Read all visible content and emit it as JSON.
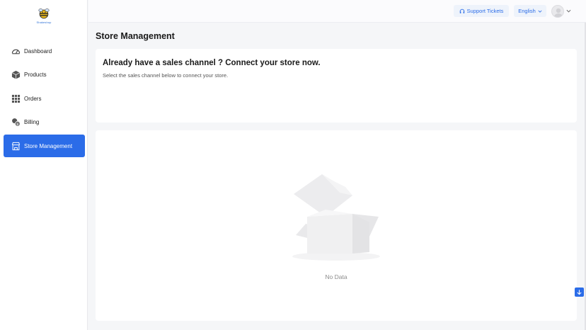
{
  "brand": {
    "logo_text": "Shakeshop"
  },
  "sidebar": {
    "items": [
      {
        "label": "Dashboard",
        "icon": "dashboard-icon"
      },
      {
        "label": "Products",
        "icon": "box-icon"
      },
      {
        "label": "Orders",
        "icon": "grid-icon"
      },
      {
        "label": "Billing",
        "icon": "coins-icon"
      },
      {
        "label": "Store Management",
        "icon": "store-icon",
        "active": true
      }
    ]
  },
  "header": {
    "support_label": "Support Tickets",
    "language_label": "English"
  },
  "main": {
    "page_title": "Store Management",
    "headline": "Already have a sales channel ? Connect your store now.",
    "subtext": "Select the sales channel below to connect your store.",
    "empty_text": "No Data"
  },
  "colors": {
    "accent": "#2b6ce8",
    "background": "#f5f6f8"
  }
}
